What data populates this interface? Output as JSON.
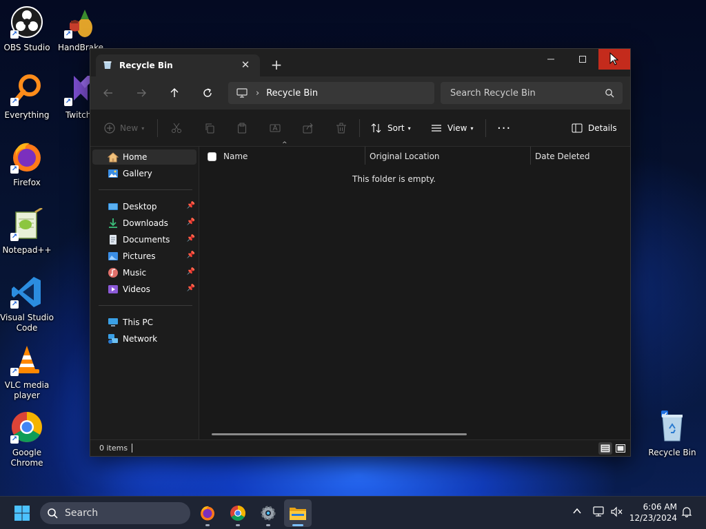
{
  "desktop": {
    "icons": [
      {
        "label": "OBS Studio"
      },
      {
        "label": "HandBrake"
      },
      {
        "label": "Everything"
      },
      {
        "label": "TwitchL"
      },
      {
        "label": "Firefox"
      },
      {
        "label": "Notepad++"
      },
      {
        "label": "Visual Studio Code"
      },
      {
        "label": "VLC media player"
      },
      {
        "label": "Google Chrome"
      },
      {
        "label": "Recycle Bin"
      }
    ]
  },
  "window": {
    "tab_title": "Recycle Bin",
    "address": {
      "location": "Recycle Bin"
    },
    "search": {
      "placeholder": "Search Recycle Bin"
    },
    "toolbar": {
      "new_label": "New",
      "sort_label": "Sort",
      "view_label": "View",
      "details_label": "Details"
    },
    "sidebar": {
      "items": [
        {
          "label": "Home",
          "icon": "home-icon"
        },
        {
          "label": "Gallery",
          "icon": "gallery-icon"
        },
        {
          "label": "Desktop",
          "icon": "desktop-icon"
        },
        {
          "label": "Downloads",
          "icon": "downloads-icon"
        },
        {
          "label": "Documents",
          "icon": "documents-icon"
        },
        {
          "label": "Pictures",
          "icon": "pictures-icon"
        },
        {
          "label": "Music",
          "icon": "music-icon"
        },
        {
          "label": "Videos",
          "icon": "videos-icon"
        },
        {
          "label": "This PC",
          "icon": "this-pc-icon"
        },
        {
          "label": "Network",
          "icon": "network-icon"
        }
      ]
    },
    "columns": [
      "Name",
      "Original Location",
      "Date Deleted"
    ],
    "empty_message": "This folder is empty.",
    "status": {
      "item_count": "0 items"
    }
  },
  "taskbar": {
    "search_placeholder": "Search",
    "clock": {
      "time": "6:06 AM",
      "date": "12/23/2024"
    }
  },
  "colors": {
    "close_button": "#c42b1c",
    "accent": "#7cc0ff"
  }
}
